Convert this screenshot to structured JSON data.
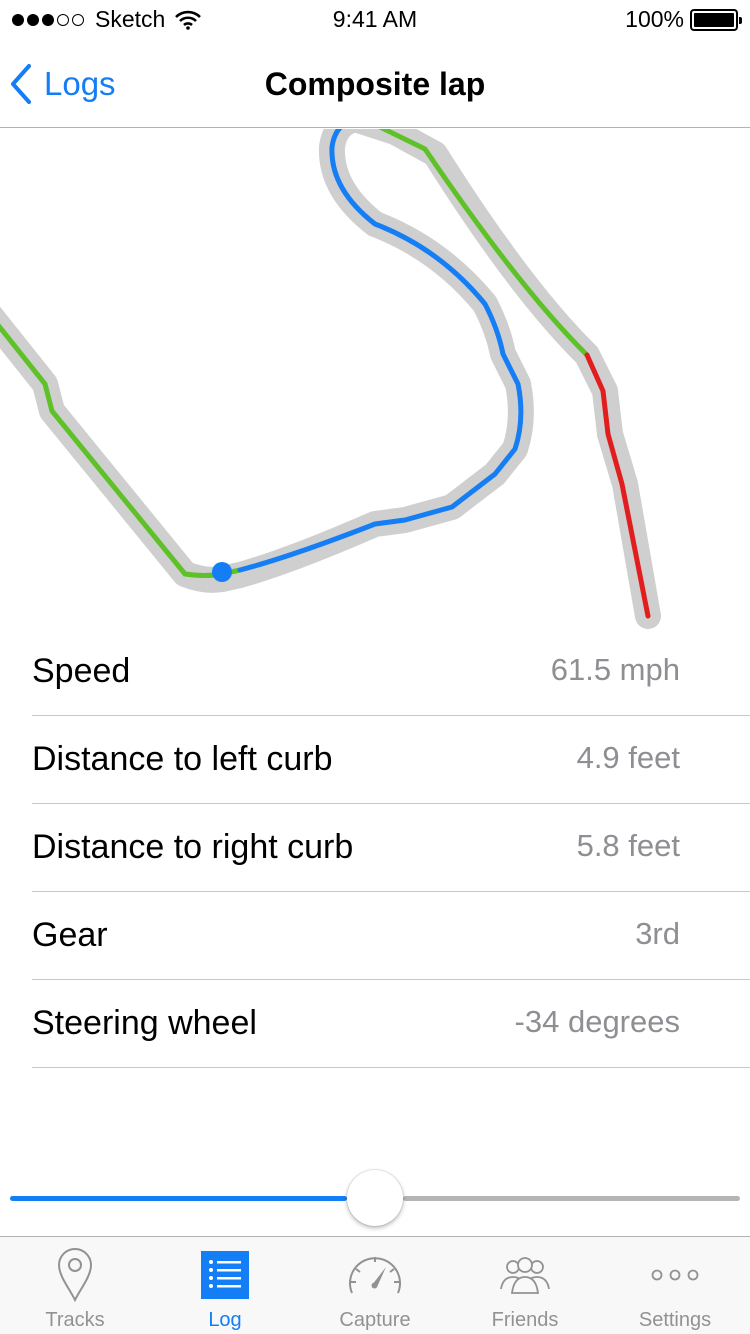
{
  "status_bar": {
    "carrier": "Sketch",
    "time": "9:41 AM",
    "battery": "100%"
  },
  "nav": {
    "back_label": "Logs",
    "title": "Composite lap"
  },
  "colors": {
    "accent": "#137ef5",
    "track_green": "#5ec128",
    "track_blue": "#157ef5",
    "track_red": "#e21d1d",
    "track_shadow": "#cfcfcf"
  },
  "metrics": [
    {
      "label": "Speed",
      "value": "61.5 mph"
    },
    {
      "label": "Distance to left curb",
      "value": "4.9 feet"
    },
    {
      "label": "Distance to right curb",
      "value": "5.8 feet"
    },
    {
      "label": "Gear",
      "value": "3rd"
    },
    {
      "label": "Steering wheel",
      "value": "-34 degrees"
    }
  ],
  "scrubber": {
    "progress": 0.5
  },
  "tabs": [
    {
      "label": "Tracks",
      "icon": "map-pin-icon",
      "active": false
    },
    {
      "label": "Log",
      "icon": "list-icon",
      "active": true
    },
    {
      "label": "Capture",
      "icon": "speedometer-icon",
      "active": false
    },
    {
      "label": "Friends",
      "icon": "friends-icon",
      "active": false
    },
    {
      "label": "Settings",
      "icon": "more-icon",
      "active": false
    }
  ]
}
